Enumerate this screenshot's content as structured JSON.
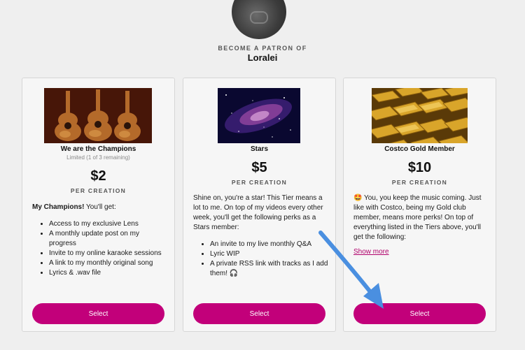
{
  "header": {
    "become_label": "BECOME A PATRON OF",
    "creator_name": "Loralei"
  },
  "tiers": [
    {
      "image_icon": "guitars-image",
      "name": "We are the Champions",
      "limit": "Limited (1 of 3 remaining)",
      "price": "$2",
      "per": "PER CREATION",
      "intro_bold": "My Champions!",
      "intro_rest": " You'll get:",
      "perks": [
        "Access to my exclusive Lens",
        "A monthly update post on my progress",
        "Invite to my online karaoke sessions",
        "A link to my monthly original song",
        "Lyrics & .wav file"
      ],
      "button": "Select"
    },
    {
      "image_icon": "galaxy-image",
      "name": "Stars",
      "price": "$5",
      "per": "PER CREATION",
      "intro": "Shine on, you're a star! This Tier means a lot to me. On top of my videos every other week, you'll get the following perks as a Stars member:",
      "perks": [
        "An invite to my live monthly Q&A",
        "Lyric WIP",
        "A private RSS link with tracks as I add them! 🎧"
      ],
      "button": "Select"
    },
    {
      "image_icon": "gold-bars-image",
      "name": "Costco Gold Member",
      "price": "$10",
      "per": "PER CREATION",
      "intro": "🤩 You,  you keep the music coming. Just like with Costco, being my Gold club member, means more perks! On top of everything listed in the Tiers above, you'll get the following:",
      "show_more": "Show more",
      "button": "Select"
    }
  ],
  "colors": {
    "accent": "#c2007a",
    "arrow": "#4a8fe0",
    "background": "#efefef"
  }
}
